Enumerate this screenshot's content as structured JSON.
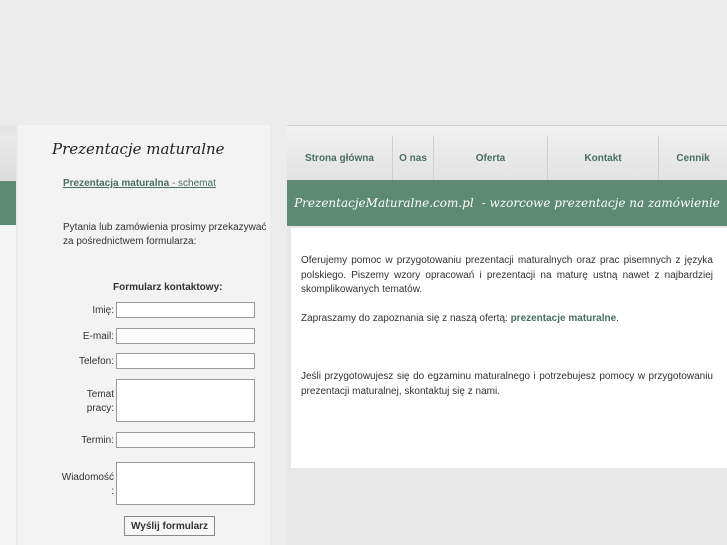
{
  "sidebar": {
    "title": "Prezentacje maturalne",
    "link_bold": "Prezentacja maturalna",
    "link_rest": " - schemat",
    "info": "Pytania lub zamówienia prosimy przekazywać za pośrednictwem formularza:",
    "form": {
      "title": "Formularz kontaktowy:",
      "imie": "Imię:",
      "email": "E-mail:",
      "telefon": "Telefon:",
      "temat_1": "Temat",
      "temat_2": "pracy:",
      "termin": "Termin:",
      "wiadomosc_1": "Wiadomość",
      "wiadomosc_2": ":",
      "submit": "Wyślij formularz"
    }
  },
  "nav": {
    "items": [
      "Strona główna",
      "O nas",
      "Oferta",
      "Kontakt",
      "Cennik"
    ]
  },
  "banner": {
    "site": "PrezentacjeMaturalne.com.pl",
    "tagline": "- wzorcowe prezentacje na zamówienie"
  },
  "content": {
    "p1": "Oferujemy pomoc w przygotowaniu prezentacji maturalnych oraz prac pisemnych z języka polskiego. Piszemy wzory opracowań i prezentacji na maturę ustną nawet z najbardziej skomplikowanych tematów.",
    "p2_text": "Zapraszamy do zapoznania się z naszą ofertą: ",
    "p2_link": "prezentacje maturalne",
    "p2_end": ".",
    "p3": "Jeśli przygotowujesz się do egzaminu maturalnego i potrzebujesz pomocy w przygotowaniu prezentacji maturalnej, skontaktuj się z nami."
  },
  "colors": {
    "accent": "#5c8a74",
    "link": "#4b6e5e",
    "background": "#ececec"
  }
}
